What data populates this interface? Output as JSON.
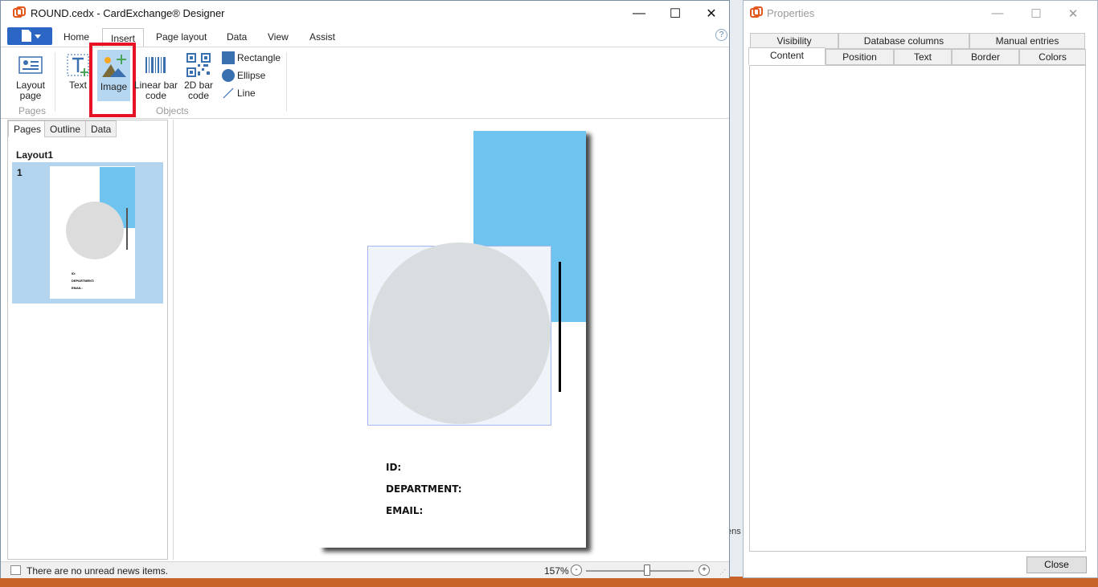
{
  "main_window": {
    "title": "ROUND.cedx - CardExchange® Designer",
    "controls": {
      "minimize": "—",
      "maximize": "☐",
      "close": "✕"
    }
  },
  "ribbon": {
    "tabs": [
      {
        "label": "Home"
      },
      {
        "label": "Insert"
      },
      {
        "label": "Page layout"
      },
      {
        "label": "Data"
      },
      {
        "label": "View"
      },
      {
        "label": "Assist"
      }
    ],
    "active_tab": "Insert",
    "help": "?",
    "pages_group": {
      "label": "Pages",
      "layout_page_line1": "Layout",
      "layout_page_line2": "page"
    },
    "objects_group": {
      "label": "Objects",
      "text": "Text",
      "image": "Image",
      "linear_line1": "Linear bar",
      "linear_line2": "code",
      "twod_line1": "2D bar",
      "twod_line2": "code",
      "rectangle": "Rectangle",
      "ellipse": "Ellipse",
      "line": "Line"
    }
  },
  "left_panel": {
    "tabs": [
      {
        "label": "Pages"
      },
      {
        "label": "Outline"
      },
      {
        "label": "Data"
      }
    ],
    "layout_name": "Layout1",
    "page_number": "1",
    "thumb_fields": [
      "ID:",
      "DEPARTMENT:",
      "EMAIL:"
    ]
  },
  "card": {
    "fields": [
      "ID:",
      "DEPARTMENT:",
      "EMAIL:"
    ]
  },
  "statusbar": {
    "news": "There are no unread news items.",
    "zoom": "157%",
    "zoom_fraction": 0.57,
    "zoom_minus": "-",
    "zoom_plus": "+"
  },
  "properties_window": {
    "title": "Properties",
    "tabs_row1": [
      {
        "label": "Visibility"
      },
      {
        "label": "Database columns"
      },
      {
        "label": "Manual entries"
      }
    ],
    "tabs_row2": [
      {
        "label": "Content"
      },
      {
        "label": "Position"
      },
      {
        "label": "Text"
      },
      {
        "label": "Border"
      },
      {
        "label": "Colors"
      }
    ],
    "close_button": "Close"
  },
  "background_fragment": "ens",
  "colors": {
    "accent": "#2b66c5",
    "highlight": "#e81123",
    "card_blue": "#6ec4ee",
    "selection": "#b6d7f1"
  }
}
